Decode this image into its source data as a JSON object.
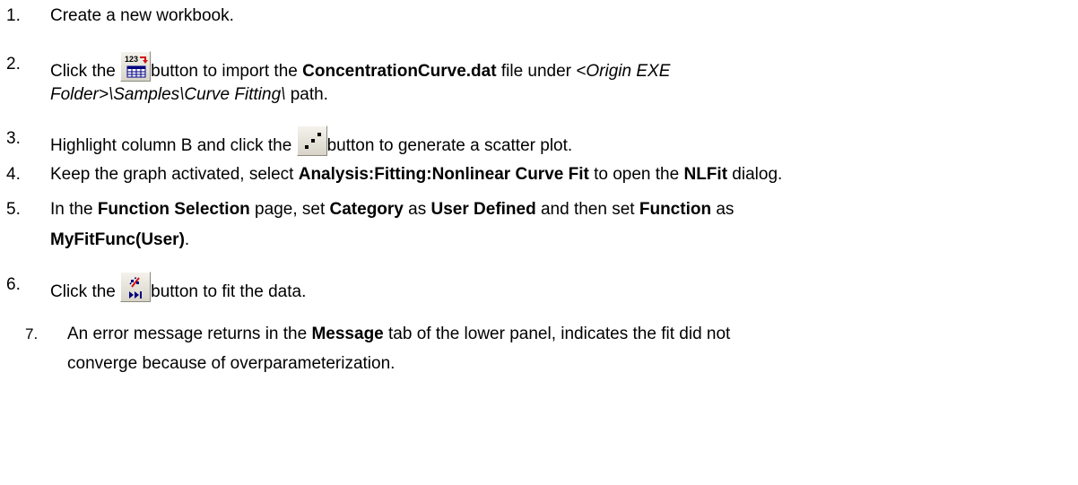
{
  "steps": [
    {
      "number": "1.",
      "text": "Create a new workbook."
    },
    {
      "number": "2.",
      "before": "Click the ",
      "icon": "import-ascii-icon",
      "after": "button to import the ",
      "file": "ConcentrationCurve.dat",
      "under": " file under ",
      "path_line1": "<Origin EXE",
      "path_line2": "Folder>\\Samples\\Curve Fitting\\",
      "path_word": " path."
    },
    {
      "number": "3.",
      "before": "Highlight column B and click the ",
      "icon": "scatter-plot-icon",
      "after": "button to generate a scatter plot."
    },
    {
      "number": "4.",
      "before": "Keep the graph activated, select ",
      "menu": "Analysis:Fitting:Nonlinear Curve Fit",
      "middle": " to open the ",
      "dialog": "NLFit",
      "after": " dialog."
    },
    {
      "number": "5.",
      "t1": "In the ",
      "b1": "Function Selection",
      "t2": " page, set ",
      "b2": "Category",
      "t3": " as ",
      "b3": "User Defined",
      "t4": " and then set ",
      "b4": "Function",
      "t5": " as",
      "b5": "MyFitFunc(User)",
      "t6": "."
    },
    {
      "number": "6.",
      "before": "Click the ",
      "icon": "fit-till-converged-icon",
      "after": "button to fit the data."
    },
    {
      "number": "7.",
      "before": "An error message returns in the ",
      "tab": "Message",
      "after_line1": " tab of the lower panel, indicates the fit did not",
      "line2": "converge because of overparameterization."
    }
  ],
  "colors": {
    "text": "#000000",
    "background": "#ffffff",
    "icon_red": "#d01010",
    "icon_blue": "#000080"
  }
}
